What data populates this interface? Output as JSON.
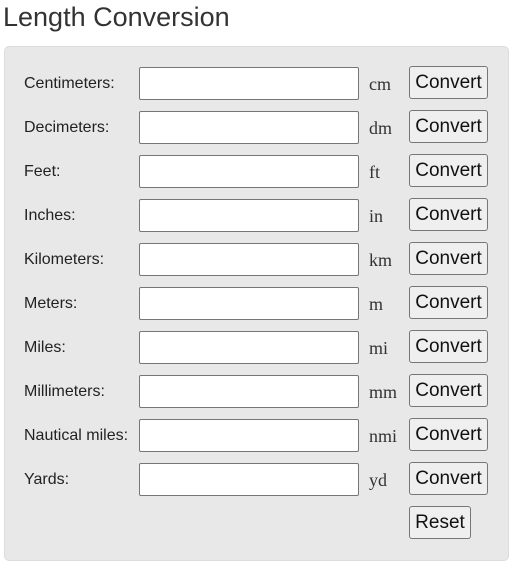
{
  "title": "Length Conversion",
  "rows": [
    {
      "label": "Centimeters:",
      "unit": "cm",
      "value": "",
      "button": "Convert"
    },
    {
      "label": "Decimeters:",
      "unit": "dm",
      "value": "",
      "button": "Convert"
    },
    {
      "label": "Feet:",
      "unit": "ft",
      "value": "",
      "button": "Convert"
    },
    {
      "label": "Inches:",
      "unit": "in",
      "value": "",
      "button": "Convert"
    },
    {
      "label": "Kilometers:",
      "unit": "km",
      "value": "",
      "button": "Convert"
    },
    {
      "label": "Meters:",
      "unit": "m",
      "value": "",
      "button": "Convert"
    },
    {
      "label": "Miles:",
      "unit": "mi",
      "value": "",
      "button": "Convert"
    },
    {
      "label": "Millimeters:",
      "unit": "mm",
      "value": "",
      "button": "Convert"
    },
    {
      "label": "Nautical miles:",
      "unit": "nmi",
      "value": "",
      "button": "Convert"
    },
    {
      "label": "Yards:",
      "unit": "yd",
      "value": "",
      "button": "Convert"
    }
  ],
  "reset_label": "Reset"
}
